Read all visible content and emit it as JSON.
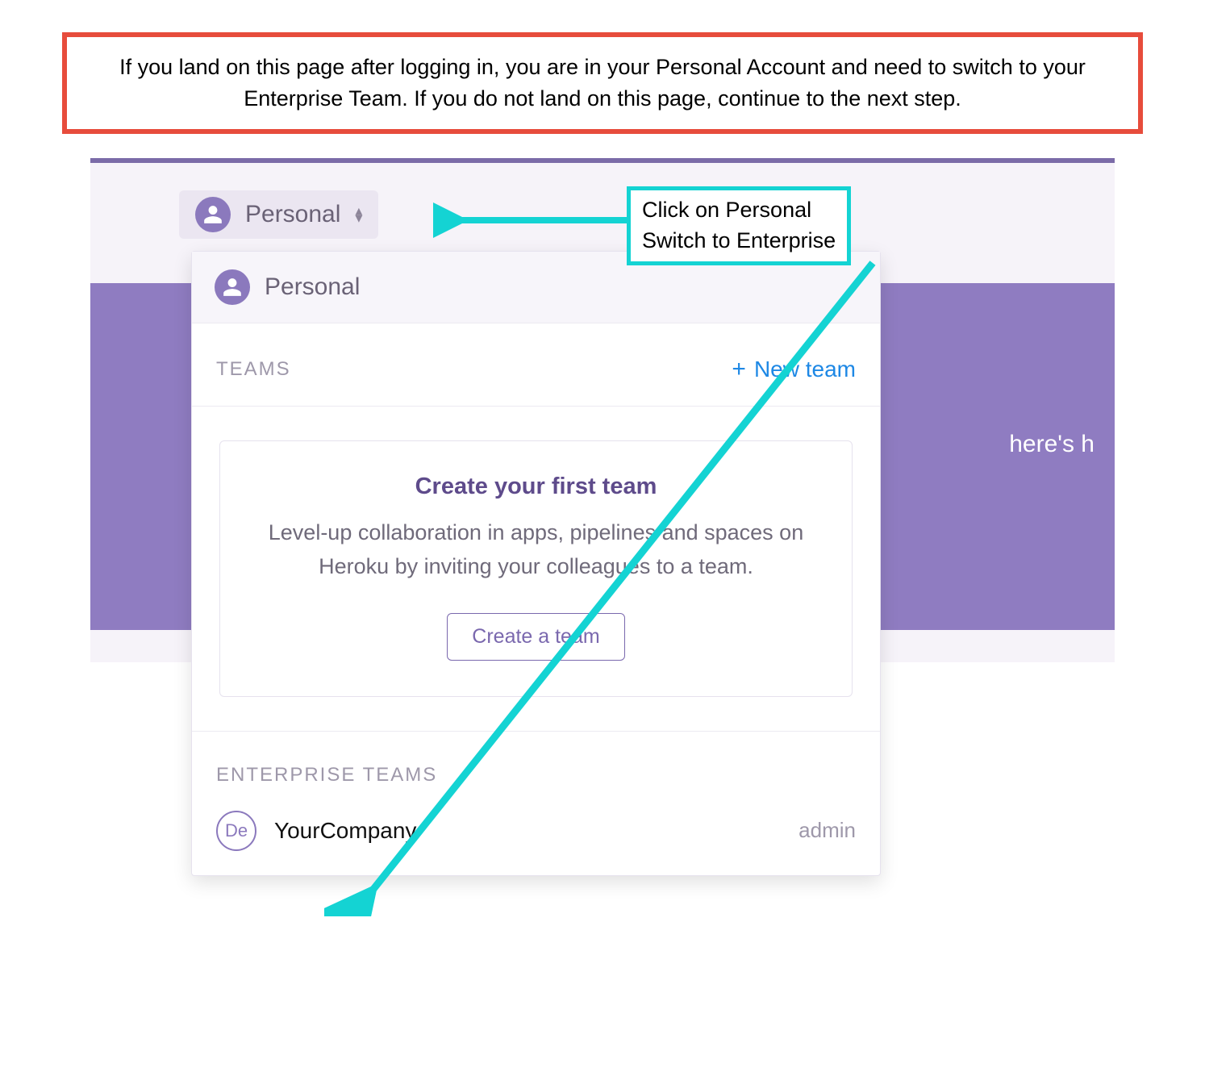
{
  "callout": "If you land on this page after logging in, you are in your Personal Account and need to switch to your Enterprise Team.  If you do not land on this page, continue to the next step.",
  "tooltip": {
    "line1": "Click on Personal",
    "line2": "Switch to Enterprise"
  },
  "selector": {
    "label": "Personal"
  },
  "dropdown": {
    "personal_label": "Personal",
    "teams_header": "TEAMS",
    "new_team_label": "New team",
    "card": {
      "title": "Create your first team",
      "body": "Level-up collaboration in apps, pipelines and spaces on Heroku by inviting your colleagues to a team.",
      "button": "Create a team"
    },
    "enterprise_header": "ENTERPRISE TEAMS",
    "enterprise_item": {
      "badge": "De",
      "name": "YourCompany",
      "role": "admin"
    }
  },
  "backdrop_text": "here's h"
}
